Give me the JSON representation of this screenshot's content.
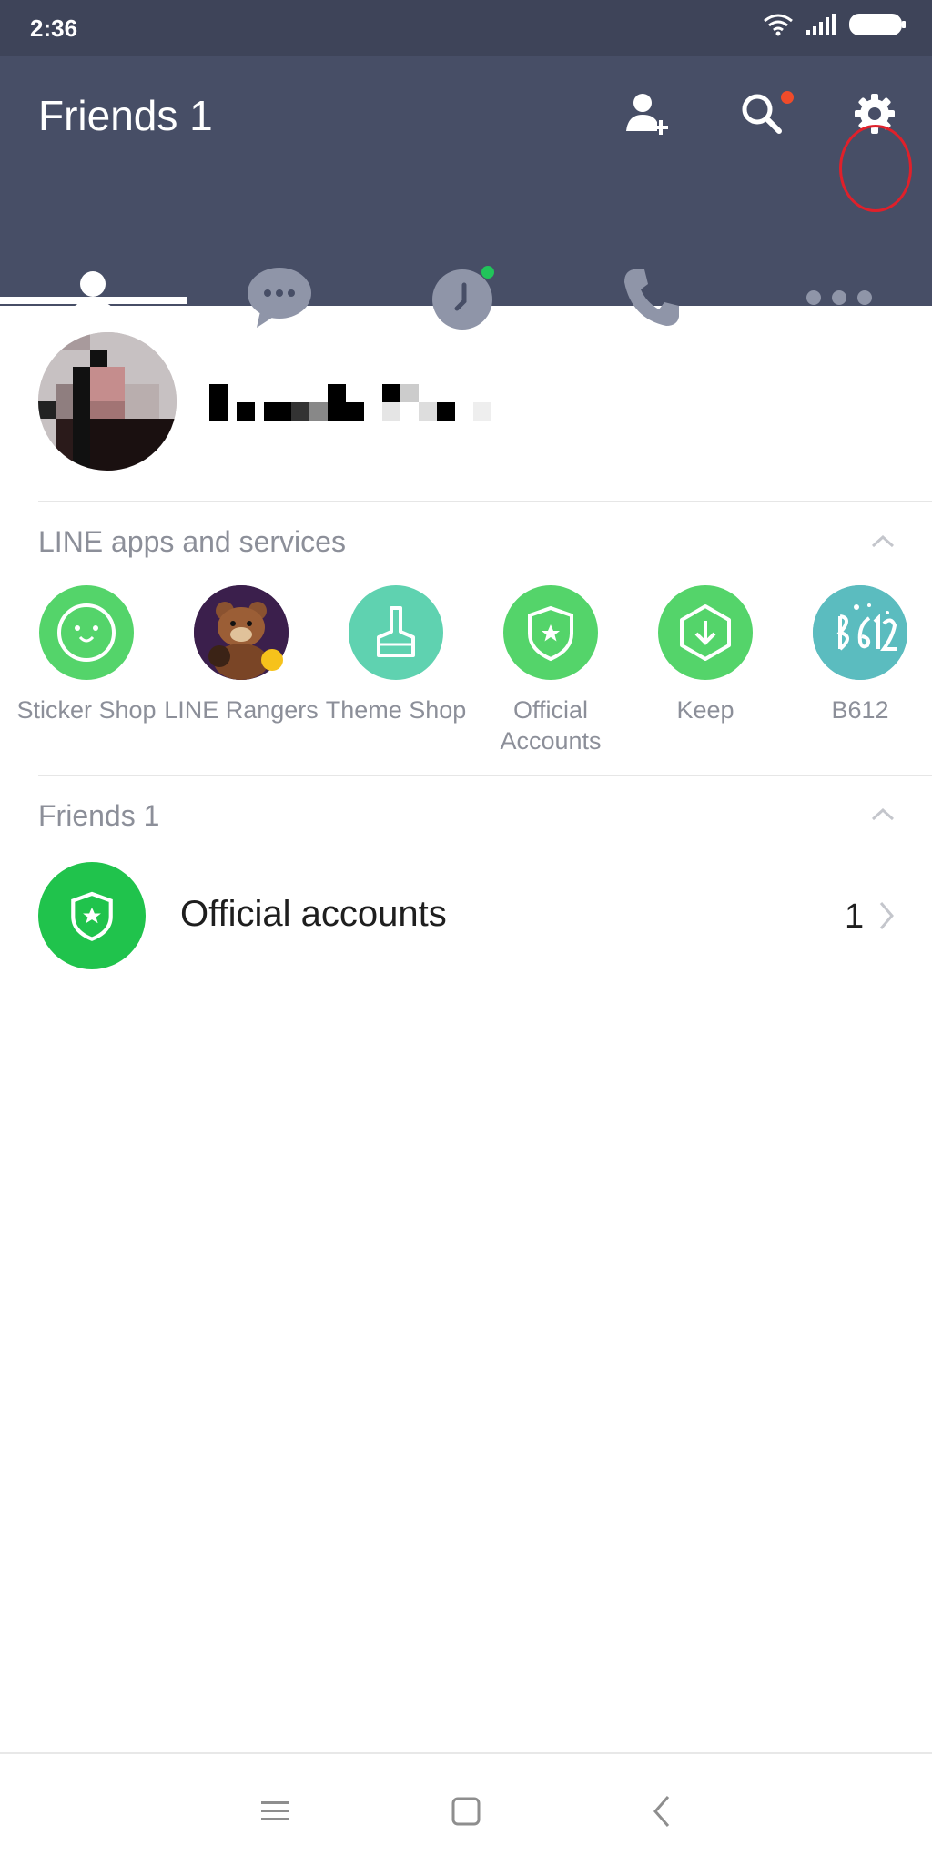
{
  "status_bar": {
    "time": "2:36"
  },
  "header": {
    "title": "Friends 1"
  },
  "profile": {
    "name": ""
  },
  "apps_section": {
    "title": "LINE apps and services",
    "apps": [
      {
        "label": "Sticker Shop",
        "color": "#54d46a"
      },
      {
        "label": "LINE Rangers",
        "color": "#3b1f4c"
      },
      {
        "label": "Theme Shop",
        "color": "#5fd2b0"
      },
      {
        "label": "Official Accounts",
        "color": "#54d46a"
      },
      {
        "label": "Keep",
        "color": "#54d46a"
      },
      {
        "label": "B612",
        "color": "#5bbcbf"
      }
    ]
  },
  "friends_section": {
    "title": "Friends 1",
    "rows": [
      {
        "label": "Official accounts",
        "count": "1"
      }
    ]
  },
  "colors": {
    "header": "#474e66",
    "status_bar": "#3e4459",
    "accent_green": "#20c34c",
    "highlight_ring": "#e0202a"
  }
}
